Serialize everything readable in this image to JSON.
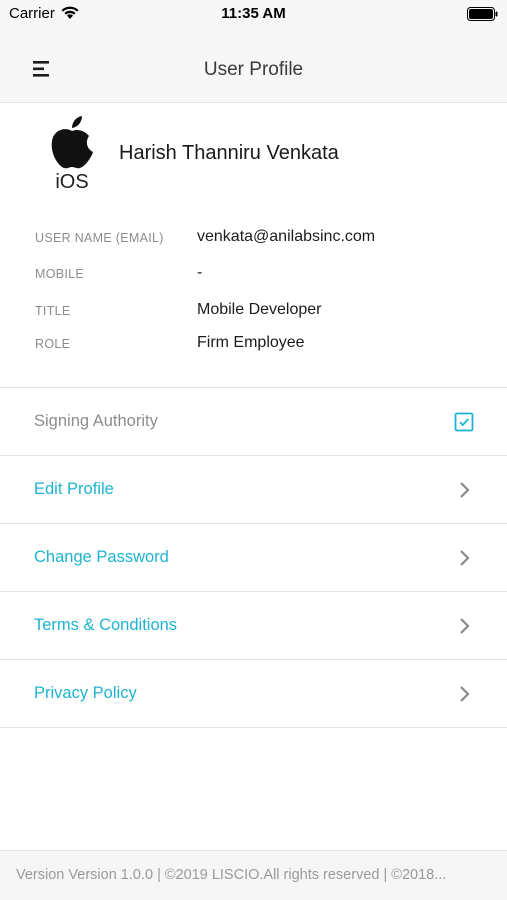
{
  "status_bar": {
    "carrier": "Carrier",
    "time": "11:35 AM"
  },
  "nav": {
    "title": "User Profile",
    "menu_icon": "hamburger-menu-icon"
  },
  "profile": {
    "avatar_text": "iOS",
    "name": "Harish Thanniru Venkata"
  },
  "details": [
    {
      "label": "USER NAME (EMAIL)",
      "value": "venkata@anilabsinc.com"
    },
    {
      "label": "MOBILE",
      "value": "-"
    },
    {
      "label": "TITLE",
      "value": "Mobile Developer"
    },
    {
      "label": "ROLE",
      "value": "Firm Employee"
    }
  ],
  "signing_authority": {
    "label": "Signing Authority",
    "checked": true
  },
  "menu": [
    {
      "label": "Edit Profile",
      "icon": "chevron-right-icon"
    },
    {
      "label": "Change Password",
      "icon": "chevron-right-icon"
    },
    {
      "label": "Terms & Conditions",
      "icon": "chevron-right-icon"
    },
    {
      "label": "Privacy Policy",
      "icon": "chevron-right-icon"
    }
  ],
  "footer": {
    "text": "Version Version 1.0.0 | ©2019 LISCIO.All rights reserved | ©2018..."
  },
  "colors": {
    "accent": "#1eb3d0",
    "muted": "#8d8d8d",
    "bar": "#f7f7f7"
  }
}
